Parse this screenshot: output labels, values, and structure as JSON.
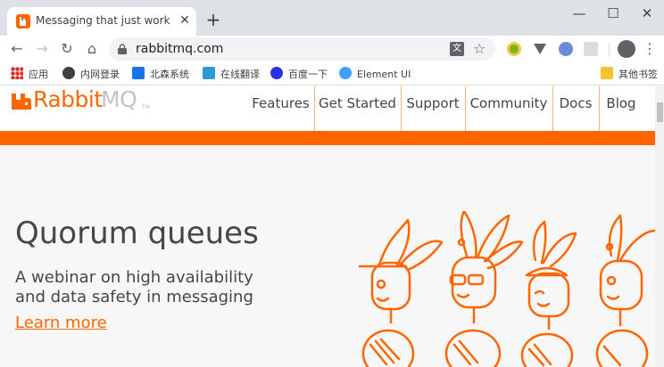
{
  "browser": {
    "tab": {
      "title": "Messaging that just works — RabbitMQ",
      "close_glyph": "✕"
    },
    "new_tab_glyph": "+",
    "window_controls": {
      "minimize": "—",
      "maximize": "☐",
      "close": "✕"
    },
    "toolbar": {
      "back_glyph": "←",
      "forward_glyph": "→",
      "reload_glyph": "↻",
      "home_glyph": "⌂",
      "url": "rabbitmq.com",
      "translate_glyph": "文",
      "star_glyph": "☆",
      "menu_glyph": "⋮"
    },
    "bookmarks": [
      {
        "label": "应用",
        "icon": "apps-grid-icon"
      },
      {
        "label": "内网登录",
        "icon": "globe-icon"
      },
      {
        "label": "北森系统",
        "icon": "beisen-icon"
      },
      {
        "label": "在线翻译",
        "icon": "translate-icon"
      },
      {
        "label": "百度一下",
        "icon": "baidu-paw-icon"
      },
      {
        "label": "Element UI",
        "icon": "element-ui-icon"
      },
      {
        "label": "其他书签",
        "icon": "folder-icon"
      }
    ]
  },
  "site": {
    "logo": {
      "part1": "Rabbit",
      "part2": "MQ",
      "tm": "TM"
    },
    "nav": [
      "Features",
      "Get Started",
      "Support",
      "Community",
      "Docs",
      "Blog"
    ],
    "hero": {
      "title": "Quorum queues",
      "subtitle_line1": "A webinar on high availability",
      "subtitle_line2": "and data safety in messaging",
      "cta": "Learn more"
    },
    "colors": {
      "brand": "#ff6600",
      "text": "#464646",
      "background": "#f7f7f7"
    }
  }
}
